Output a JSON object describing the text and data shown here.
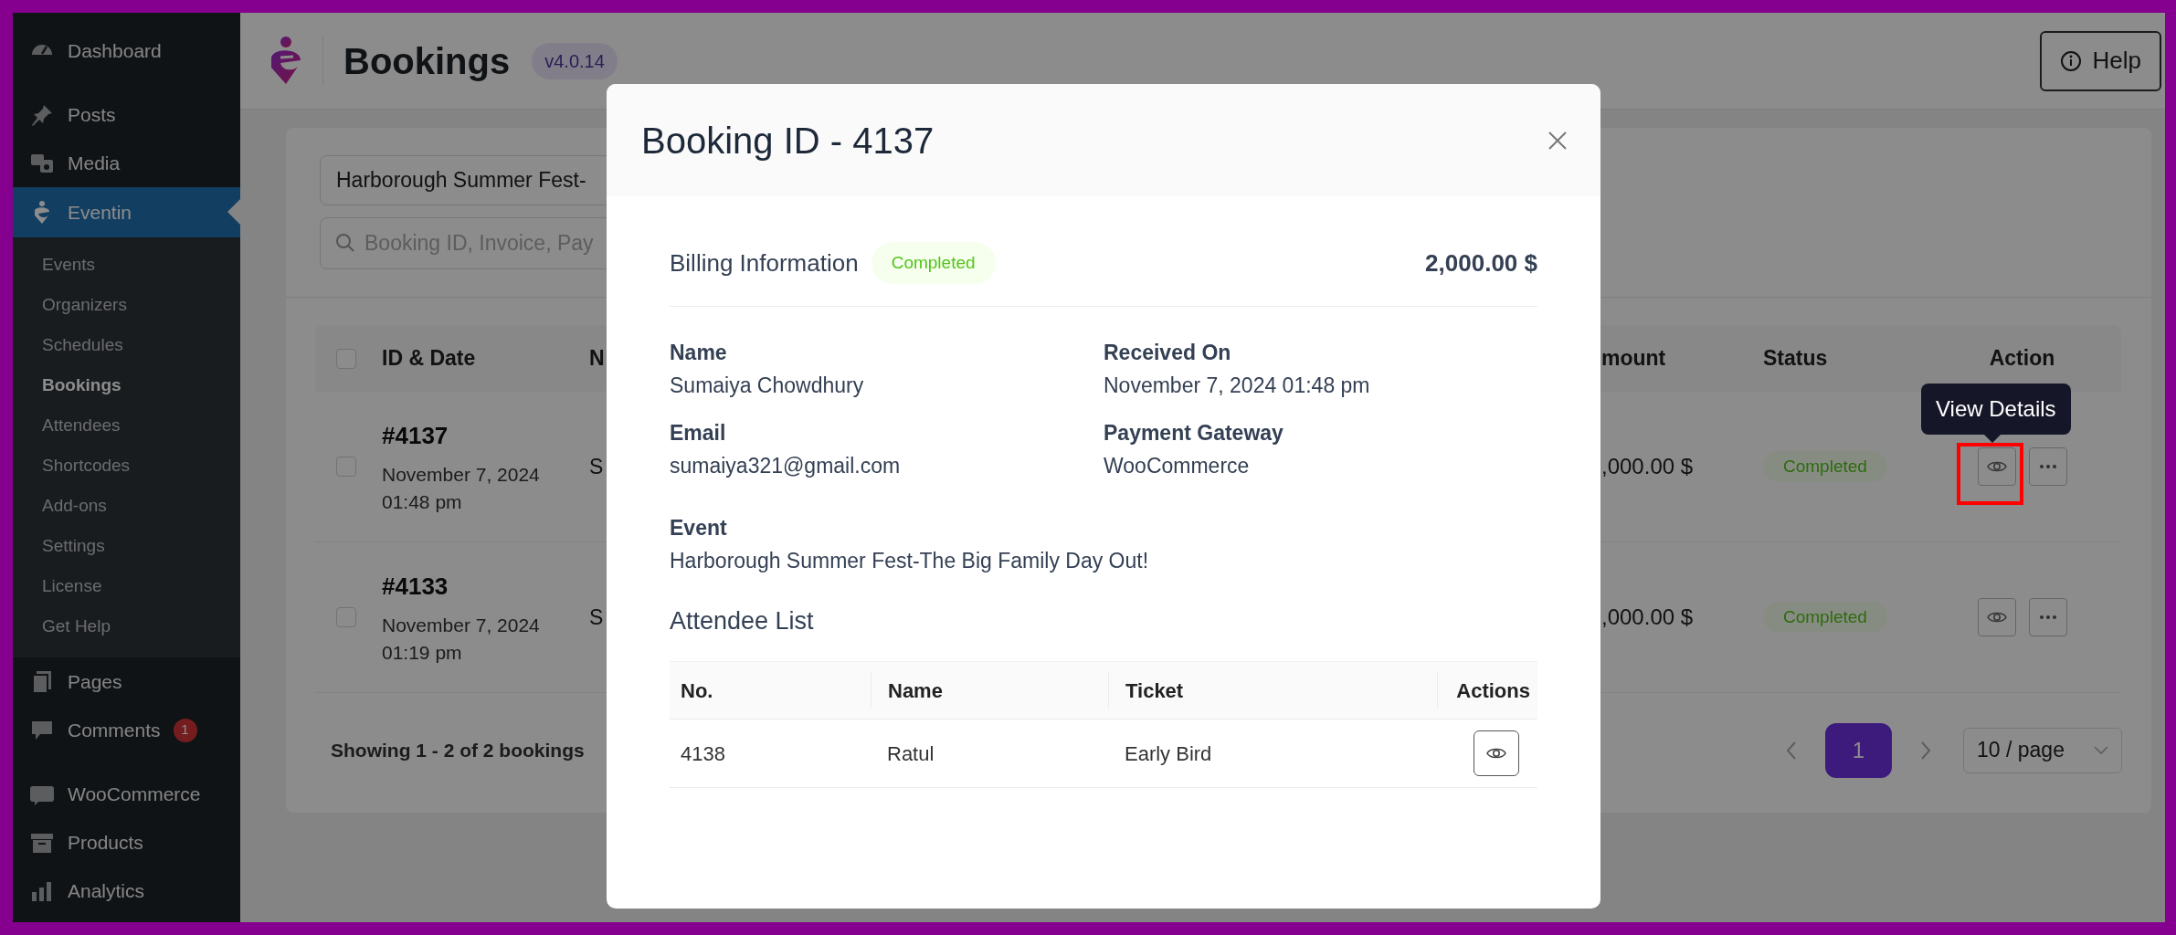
{
  "sidebar": {
    "items": [
      {
        "label": "Dashboard",
        "selected": false
      },
      {
        "label": "Posts",
        "selected": false
      },
      {
        "label": "Media",
        "selected": false
      },
      {
        "label": "Eventin",
        "selected": true,
        "children": [
          {
            "label": "Events",
            "selected": false
          },
          {
            "label": "Organizers",
            "selected": false
          },
          {
            "label": "Schedules",
            "selected": false
          },
          {
            "label": "Bookings",
            "selected": true
          },
          {
            "label": "Attendees",
            "selected": false
          },
          {
            "label": "Shortcodes",
            "selected": false
          },
          {
            "label": "Add-ons",
            "selected": false
          },
          {
            "label": "Settings",
            "selected": false
          },
          {
            "label": "License",
            "selected": false
          },
          {
            "label": "Get Help",
            "selected": false
          }
        ]
      },
      {
        "label": "Pages",
        "selected": false
      },
      {
        "label": "Comments",
        "selected": false,
        "badge": "1"
      },
      {
        "label": "WooCommerce",
        "selected": false
      },
      {
        "label": "Products",
        "selected": false
      },
      {
        "label": "Analytics",
        "selected": false
      }
    ]
  },
  "header": {
    "title": "Bookings",
    "version": "v4.0.14",
    "help_button": "Help"
  },
  "filters": {
    "event_select": "Harborough Summer Fest-",
    "search": {
      "placeholder": "Booking ID, Invoice, Pay"
    }
  },
  "table": {
    "select_all_checked": false,
    "columns": [
      "ID & Date",
      "N",
      "mount",
      "Status",
      "Action"
    ],
    "rows": [
      {
        "checked": false,
        "id": "#4137",
        "date": "November 7, 2024",
        "time": "01:48 pm",
        "name": "S",
        "amount": ",000.00 $",
        "status": "Completed"
      },
      {
        "checked": false,
        "id": "#4133",
        "date": "November 7, 2024",
        "time": "01:19 pm",
        "name": "S",
        "amount": ",000.00 $",
        "status": "Completed"
      }
    ]
  },
  "tooltip": "View Details",
  "footer": {
    "summary": "Showing 1 - 2 of 2 bookings",
    "pages": [
      {
        "label": "1",
        "selected": true
      }
    ],
    "per_page": "10 / page"
  },
  "modal": {
    "title": "Booking ID - 4137",
    "billing": {
      "heading": "Billing Information",
      "status": "Completed",
      "total": "2,000.00 $"
    },
    "fields": [
      {
        "label": "Name",
        "value": "Sumaiya Chowdhury"
      },
      {
        "label": "Received On",
        "value": "November 7, 2024 01:48 pm"
      },
      {
        "label": "Email",
        "value": "sumaiya321@gmail.com"
      },
      {
        "label": "Payment Gateway",
        "value": "WooCommerce"
      },
      {
        "label": "Event",
        "value": "Harborough Summer Fest-The Big Family Day Out!"
      }
    ],
    "attendees": {
      "heading": "Attendee List",
      "columns": [
        "No.",
        "Name",
        "Ticket",
        "Actions"
      ],
      "rows": [
        {
          "no": "4138",
          "name": "Ratul",
          "ticket": "Early Bird"
        }
      ]
    }
  }
}
